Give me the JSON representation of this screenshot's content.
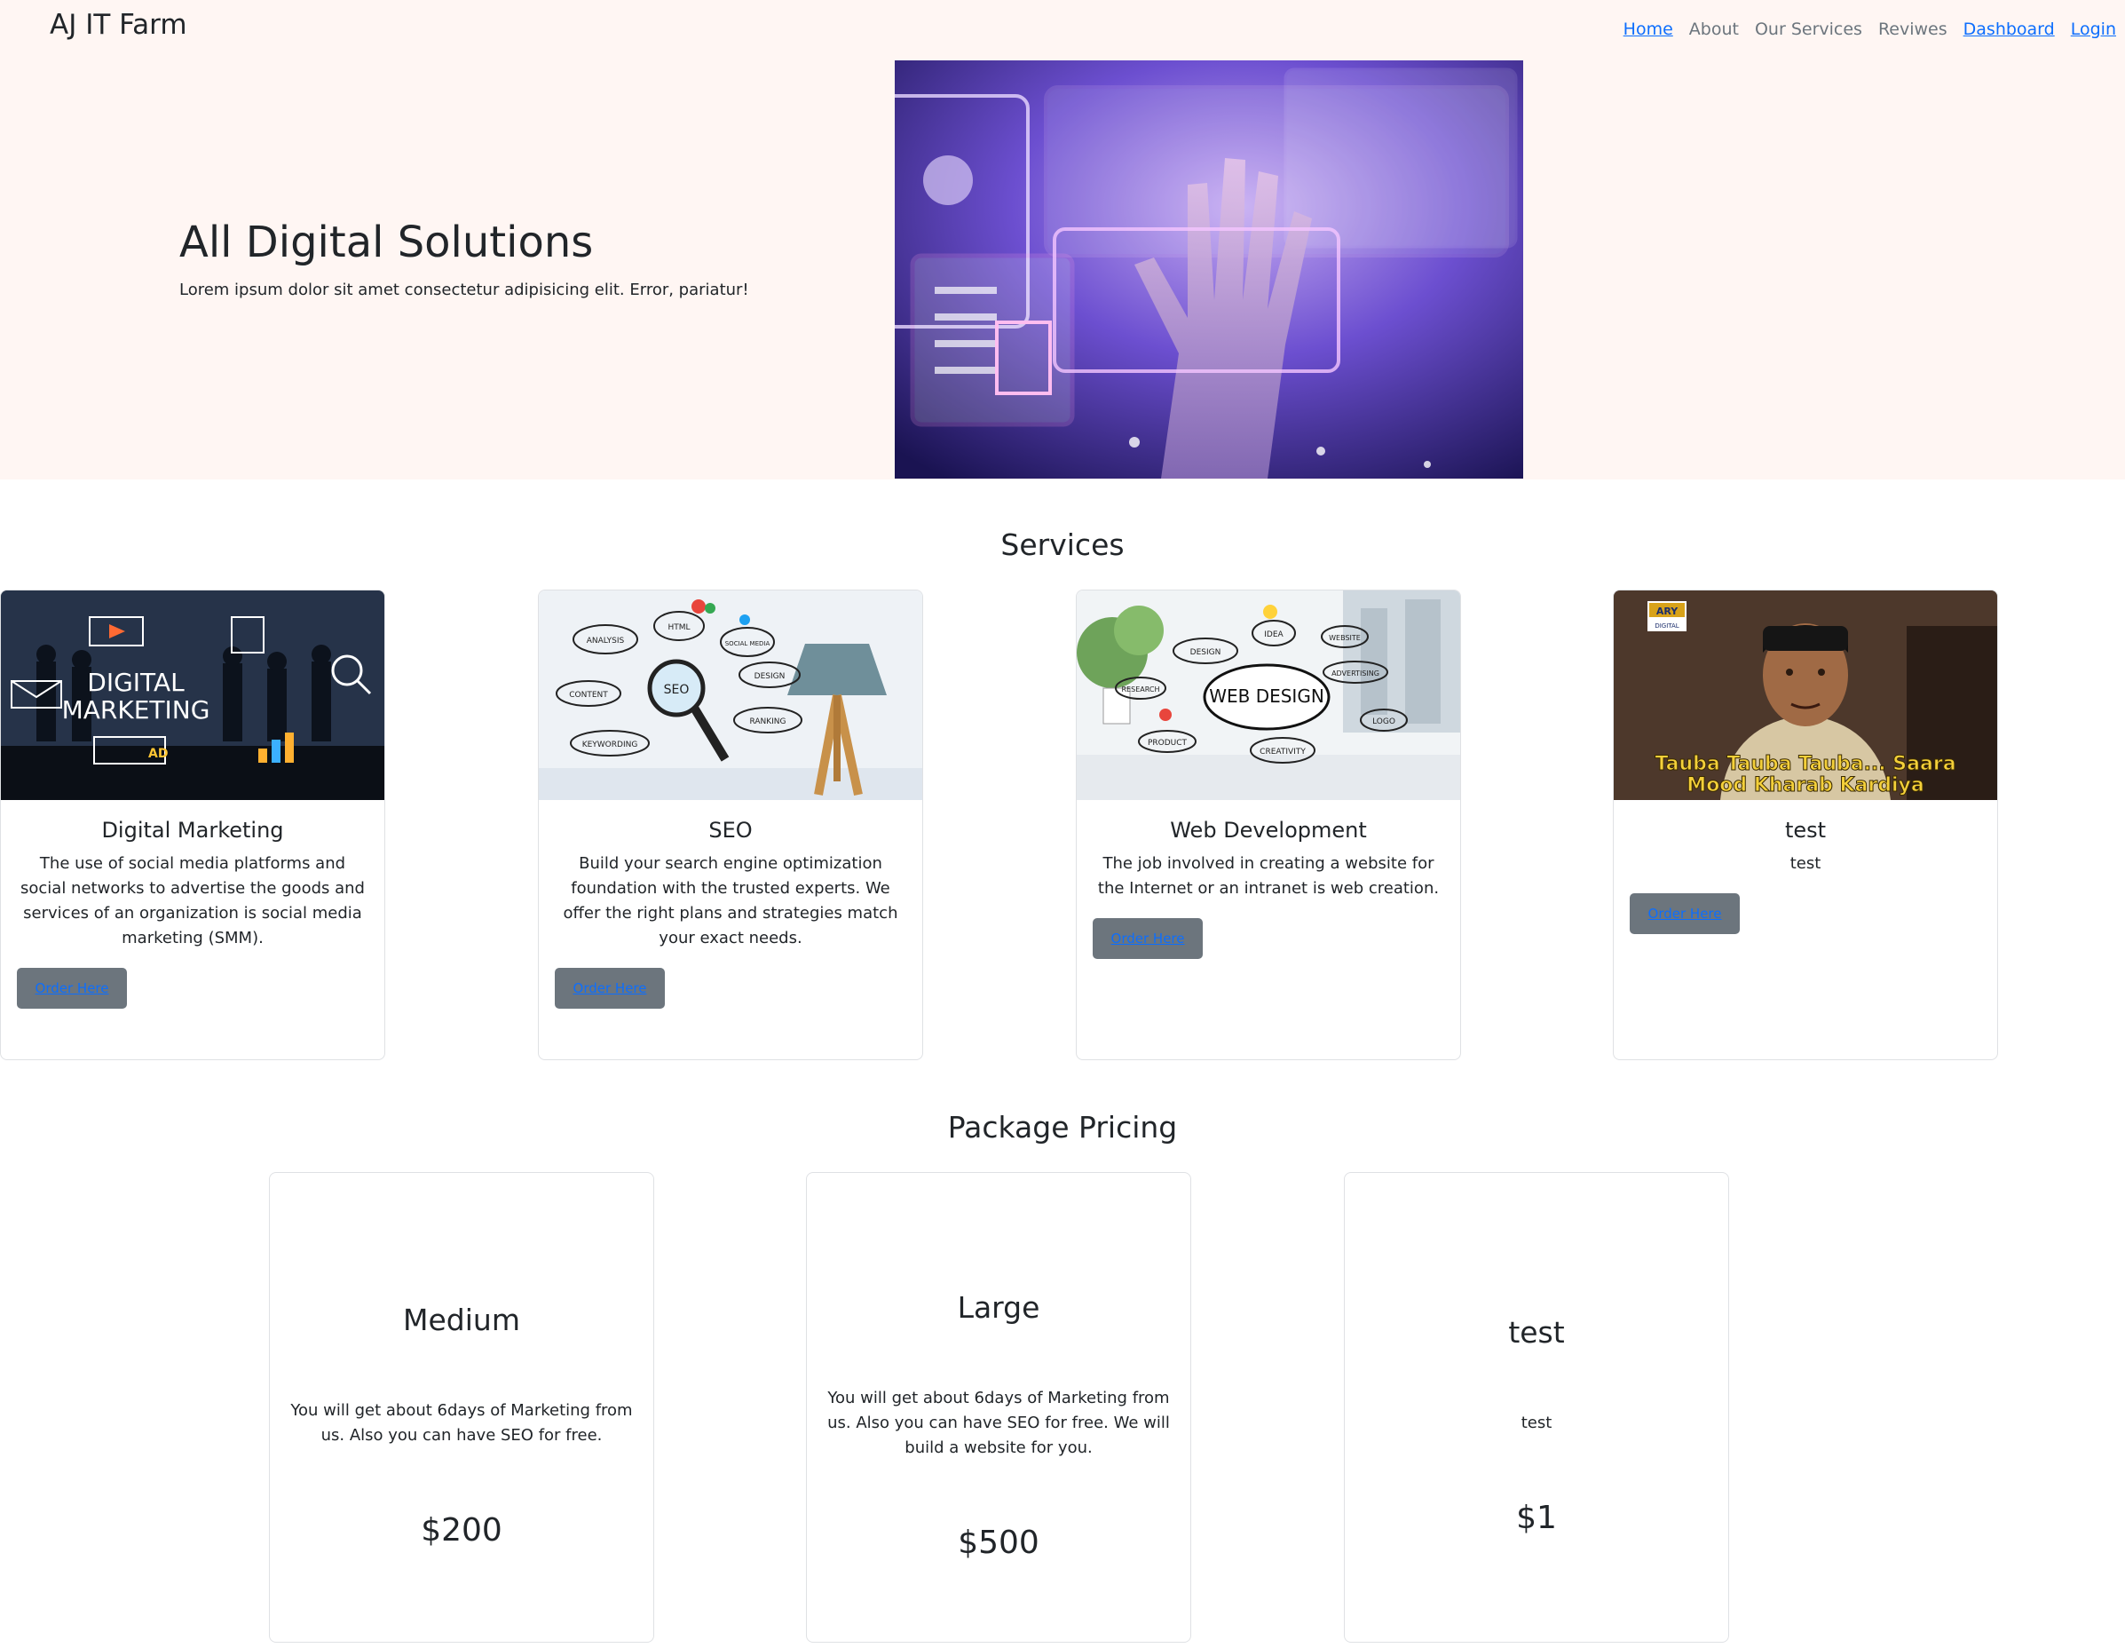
{
  "nav": {
    "brand": "AJ IT Farm",
    "links": [
      "Home",
      "About",
      "Our Services",
      "Reviwes",
      "Dashboard",
      "Login"
    ]
  },
  "hero": {
    "title": "All Digital Solutions",
    "subtitle": "Lorem ipsum dolor sit amet consectetur adipisicing elit. Error, pariatur!"
  },
  "services": {
    "title": "Services",
    "cards": [
      {
        "title": "Digital Marketing",
        "text": "The use of social media platforms and social networks to advertise the goods and services of an organization is social media marketing (SMM).",
        "button": "Order Here",
        "image_text": [
          "DIGITAL",
          "MARKETING",
          "AD"
        ]
      },
      {
        "title": "SEO",
        "text": "Build your search engine optimization foundation with the trusted experts. We offer the right plans and strategies match your exact needs.",
        "button": "Order Here",
        "image_text": [
          "ANALYSIS",
          "HTML",
          "SOCIAL MEDIA",
          "SEO",
          "DESIGN",
          "CONTENT",
          "RANKING",
          "KEYWORDING"
        ]
      },
      {
        "title": "Web Development",
        "text": "The job involved in creating a website for the Internet or an intranet is web creation.",
        "button": "Order Here",
        "image_text": [
          "DESIGN",
          "IDEA",
          "WEBSITE",
          "RESEARCH",
          "WEB DESIGN",
          "ADVERTISING",
          "PRODUCT",
          "LOGO",
          "CREATIVITY"
        ]
      },
      {
        "title": "test",
        "text": "test",
        "button": "Order Here",
        "image_text": [
          "ARY",
          "DIGITAL",
          "Tauba Tauba Tauba... Saara",
          "Mood Kharab Kardiya"
        ]
      }
    ]
  },
  "pricing": {
    "title": "Package Pricing",
    "cards": [
      {
        "name": "Medium",
        "desc": "You will get about 6days of Marketing from us. Also you can have SEO for free.",
        "price": "$200"
      },
      {
        "name": "Large",
        "desc": "You will get about 6days of Marketing from us. Also you can have SEO for free. We will build a website for you.",
        "price": "$500"
      },
      {
        "name": "test",
        "desc": "test",
        "price": "$1"
      }
    ]
  },
  "colors": {
    "hero_bg": "#fff6f3",
    "link": "#0d6efd",
    "button_bg": "#6c757d",
    "card_border": "#dfe1e4"
  }
}
